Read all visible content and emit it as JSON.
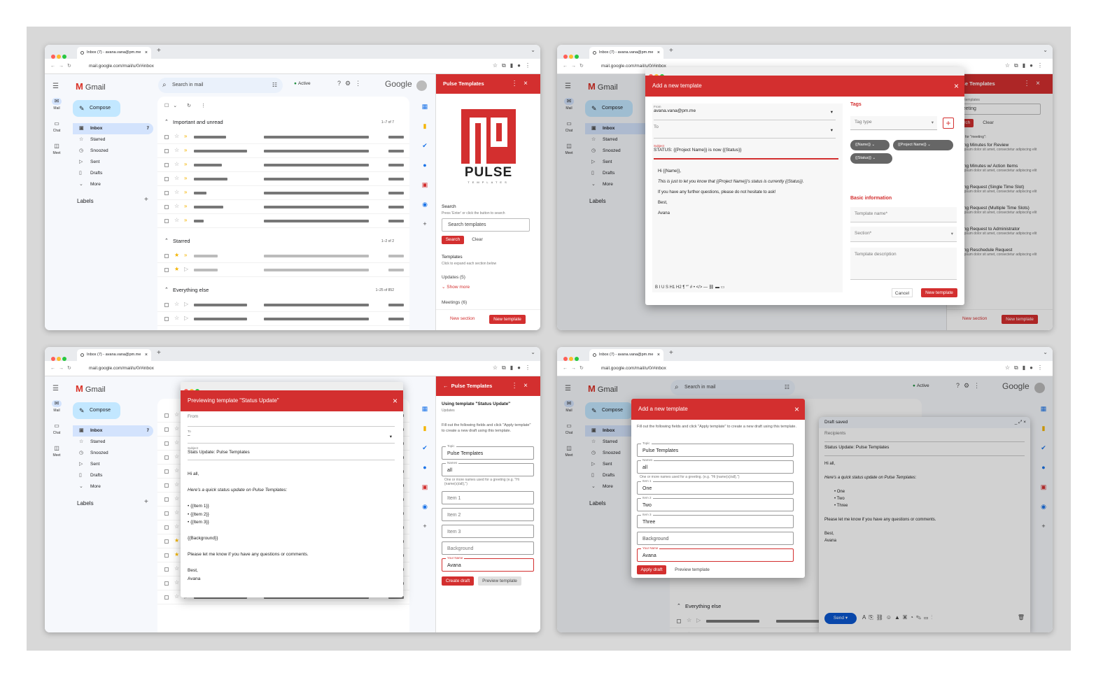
{
  "browser": {
    "tab_title": "Inbox (7) - avana.vana@pm.me",
    "url": "mail.google.com/mail/u/0/#inbox"
  },
  "gmail": {
    "logo": "Gmail",
    "search_placeholder": "Search in mail",
    "status": "Active",
    "google": "Google",
    "compose": "Compose",
    "rail": [
      "Mail",
      "Chat",
      "Meet"
    ],
    "rail_badge": "7",
    "folders": [
      {
        "icon": "inbox-icon",
        "label": "Inbox",
        "count": "7"
      },
      {
        "icon": "star-icon",
        "label": "Starred",
        "count": ""
      },
      {
        "icon": "clock-icon",
        "label": "Snoozed",
        "count": ""
      },
      {
        "icon": "send-icon",
        "label": "Sent",
        "count": ""
      },
      {
        "icon": "draft-icon",
        "label": "Drafts",
        "count": ""
      },
      {
        "icon": "chevron-down-icon",
        "label": "More",
        "count": ""
      }
    ],
    "labels_heading": "Labels",
    "sections": [
      {
        "title": "Important and unread",
        "count": "1–7 of 7"
      },
      {
        "title": "Starred",
        "count": "1–2 of 2"
      },
      {
        "title": "Everything else",
        "count": "1–25 of 852"
      }
    ]
  },
  "pulse_panel": {
    "title": "Pulse Templates",
    "logo_word": "PULSE",
    "logo_sub": "TEMPLATES",
    "search_heading": "Search",
    "search_hint": "Press 'Enter' or click the button to search",
    "search_placeholder": "Search templates",
    "search_button": "Search",
    "clear_button": "Clear",
    "templates_heading": "Templates",
    "templates_hint": "Click to expand each section below",
    "section_updates": "Updates (5)",
    "show_more": "Show more",
    "section_meetings": "Meetings (6)",
    "new_section": "New section",
    "new_template": "New template"
  },
  "add_template_dialog": {
    "title": "Add a new template",
    "from_label": "From",
    "from_value": "avana.vana@pm.me",
    "to_label": "To",
    "subject_label": "Subject",
    "subject_value": "STATUS: {{Project Name}} is now {{Status}}",
    "body": [
      "Hi {{Name}},",
      "This is just to let you know that {{Project Name}}'s status is currently {{Status}}.",
      "If you have any further questions, please do not hesitate to ask!",
      "Best,",
      "Avana"
    ],
    "toolbar": "B  I  U  S  H1  H2  ¶  “”  #  •  </>  —  ⛓  ▬  ▭",
    "tags_heading": "Tags",
    "tag_type": "Tag type",
    "chips": [
      "{{Name}}",
      "{{Project Name}}",
      "{{Status}}"
    ],
    "basic_info": "Basic information",
    "template_name": "Template name*",
    "section": "Section*",
    "description": "Template description",
    "cancel": "Cancel",
    "submit": "New template"
  },
  "search_results": {
    "search_label": "Search templates",
    "query": "meeting",
    "results_label": "Results for \"meeting\":",
    "items": [
      "Meeting Minutes for Review",
      "Meeting Minutes w/ Action Items",
      "Meeting Request (Single Time Slot)",
      "Meeting Request (Multiple Time Slots)",
      "Meeting Request to Administrator",
      "Meeting Reschedule Request"
    ],
    "lorem": "Lorem ipsum dolor sit amet, consectetur adipiscing elit"
  },
  "preview_dialog": {
    "title": "Previewing template \"Status Update\"",
    "from_label": "From",
    "to_label": "To",
    "to_value": "–",
    "subject_label": "Subject",
    "subject_value": "Stats Update: Pulse Templates",
    "body": [
      "Hi all,",
      "Here's a quick status update on Pulse Templates:",
      "• {{Item 1}}",
      "• {{Item 2}}",
      "• {{Item 3}}",
      "{{Background}}",
      "Please let me know if you have any questions or comments.",
      "Best,",
      "Avana"
    ]
  },
  "using_panel": {
    "title": "Pulse Templates",
    "heading": "Using template \"Status Update\"",
    "subheading": "Updates",
    "instructions": "Fill out the following fields and click \"Apply template\" to create a new draft using this template.",
    "fields": [
      {
        "label": "Topic",
        "value": "Pulse Templates",
        "hint": ""
      },
      {
        "label": "Names",
        "value": "all",
        "hint": "One or more names used for a greeting (e.g. \"Hi {name(s)/all},\")"
      },
      {
        "label": "",
        "value": "Item 1",
        "hint": ""
      },
      {
        "label": "",
        "value": "Item 2",
        "hint": ""
      },
      {
        "label": "",
        "value": "Item 3",
        "hint": ""
      },
      {
        "label": "",
        "value": "Background",
        "hint": ""
      },
      {
        "label": "Your Name",
        "value": "Avana",
        "hint": ""
      }
    ],
    "create_draft": "Create draft",
    "preview_template": "Preview template"
  },
  "apply_dialog": {
    "title": "Add a new template",
    "instructions": "Fill out the following fields and click \"Apply template\" to create a new draft using this template.",
    "fields": [
      {
        "label": "Topic",
        "value": "Pulse Templates"
      },
      {
        "label": "Names",
        "value": "all"
      },
      {
        "label": "Item 1",
        "value": "One"
      },
      {
        "label": "Item 2",
        "value": "Two"
      },
      {
        "label": "Item 3",
        "value": "Three"
      },
      {
        "label": "",
        "value": "Background"
      },
      {
        "label": "Your Name",
        "value": "Avana"
      }
    ],
    "names_hint": "One or more names used for a greeting. (e.g. \"Hi {name(s)/all},\")",
    "apply": "Apply draft",
    "preview": "Preview template"
  },
  "draft": {
    "title": "Draft saved",
    "recipients": "Recipients",
    "subject": "Status Update: Pulse Templates",
    "greeting": "Hi all,",
    "intro": "Here's a quick status update on Pulse Templates:",
    "items": [
      "One",
      "Two",
      "Three"
    ],
    "closing": "Please let me know if you have any questions or comments.",
    "signoff": "Best,",
    "name": "Avana",
    "send": "Send"
  },
  "colors": {
    "accent": "#d32f2f",
    "gmail_blue": "#c2e7ff",
    "stage": "#d8d8d8"
  }
}
